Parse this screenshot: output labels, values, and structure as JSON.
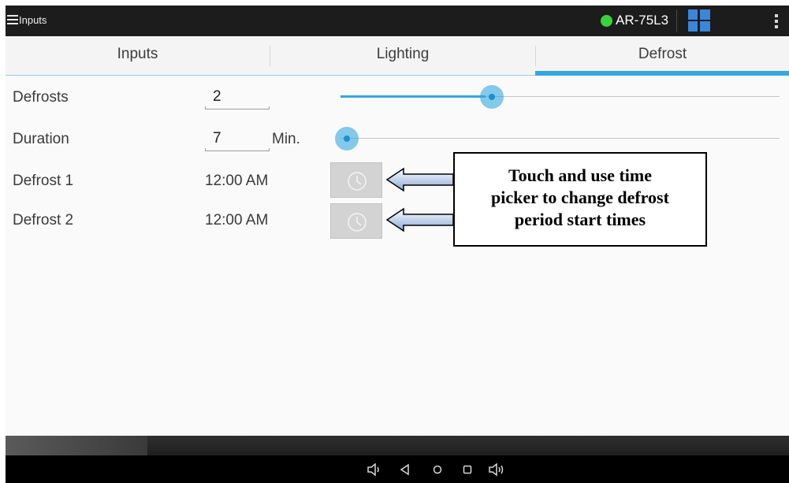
{
  "action_bar": {
    "title": "Inputs",
    "device_name": "AR-75L3",
    "status_color": "#3ad23a"
  },
  "tabs": [
    {
      "label": "Inputs",
      "selected": false
    },
    {
      "label": "Lighting",
      "selected": false
    },
    {
      "label": "Defrost",
      "selected": true
    }
  ],
  "accent_color": "#33a8df",
  "defrost": {
    "defrosts": {
      "label": "Defrosts",
      "value": "2",
      "slider_fraction": 0.33
    },
    "duration": {
      "label": "Duration",
      "value": "7",
      "unit": "Min.",
      "slider_fraction": 0.0
    },
    "periods": [
      {
        "label": "Defrost 1",
        "time": "12:00 AM",
        "icon": "clock-icon"
      },
      {
        "label": "Defrost 2",
        "time": "12:00 AM",
        "icon": "clock-icon"
      }
    ]
  },
  "annotation": {
    "lines": [
      "Touch and use time",
      "picker to change defrost",
      "period start times"
    ]
  },
  "nav_bar": {
    "icons": [
      "volume-down-icon",
      "back-icon",
      "home-icon",
      "recents-icon",
      "volume-up-icon"
    ]
  }
}
